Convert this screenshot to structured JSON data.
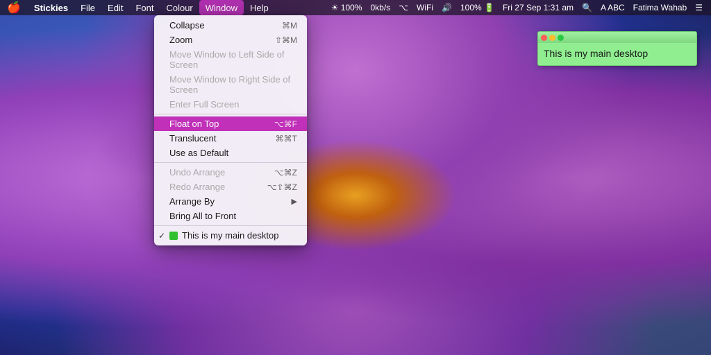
{
  "desktop": {
    "bg_description": "purple flower macro photo"
  },
  "menubar": {
    "apple": "🍎",
    "app_name": "Stickies",
    "file": "File",
    "edit": "Edit",
    "font": "Font",
    "colour": "Colour",
    "window": "Window",
    "help": "Help",
    "right": {
      "brightness": "☀",
      "brightness_pct": "100%",
      "network": "0kb/s",
      "bluetooth": "𝔹",
      "wifi": "WiFi",
      "volume": "🔊",
      "battery_pct": "100%",
      "battery_icon": "🔋",
      "datetime": "Fri 27 Sep  1:31 am",
      "spotlight": "🔍",
      "abc": "A ABC",
      "user": "Fatima Wahab",
      "notification": "☰"
    }
  },
  "window_menu": {
    "items": [
      {
        "id": "collapse",
        "label": "Collapse",
        "shortcut": "⌘M",
        "disabled": false
      },
      {
        "id": "zoom",
        "label": "Zoom",
        "shortcut": "⇧⌘M",
        "disabled": false
      },
      {
        "id": "move-left",
        "label": "Move Window to Left Side of Screen",
        "shortcut": "",
        "disabled": true
      },
      {
        "id": "move-right",
        "label": "Move Window to Right Side of Screen",
        "shortcut": "",
        "disabled": true
      },
      {
        "id": "enter-fullscreen",
        "label": "Enter Full Screen",
        "shortcut": "",
        "disabled": true
      },
      {
        "separator": true
      },
      {
        "id": "float-on-top",
        "label": "Float on Top",
        "shortcut": "⌥⌘F",
        "highlighted": true,
        "disabled": false
      },
      {
        "id": "translucent",
        "label": "Translucent",
        "shortcut": "⌘⌘T",
        "disabled": false
      },
      {
        "id": "use-as-default",
        "label": "Use as Default",
        "shortcut": "",
        "disabled": false
      },
      {
        "separator": true
      },
      {
        "id": "undo-arrange",
        "label": "Undo Arrange",
        "shortcut": "⌥⌘Z",
        "disabled": true
      },
      {
        "id": "redo-arrange",
        "label": "Redo Arrange",
        "shortcut": "⌥⇧⌘Z",
        "disabled": true
      },
      {
        "id": "arrange-by",
        "label": "Arrange By",
        "shortcut": "",
        "has_arrow": true,
        "disabled": false
      },
      {
        "id": "bring-all-front",
        "label": "Bring All to Front",
        "shortcut": "",
        "disabled": false
      },
      {
        "separator": true
      },
      {
        "id": "main-desktop",
        "label": "This is my main desktop",
        "shortcut": "",
        "checked": true,
        "has_green": true,
        "disabled": false
      }
    ]
  },
  "sticky_note": {
    "title": "",
    "content": "This is my main desktop"
  }
}
